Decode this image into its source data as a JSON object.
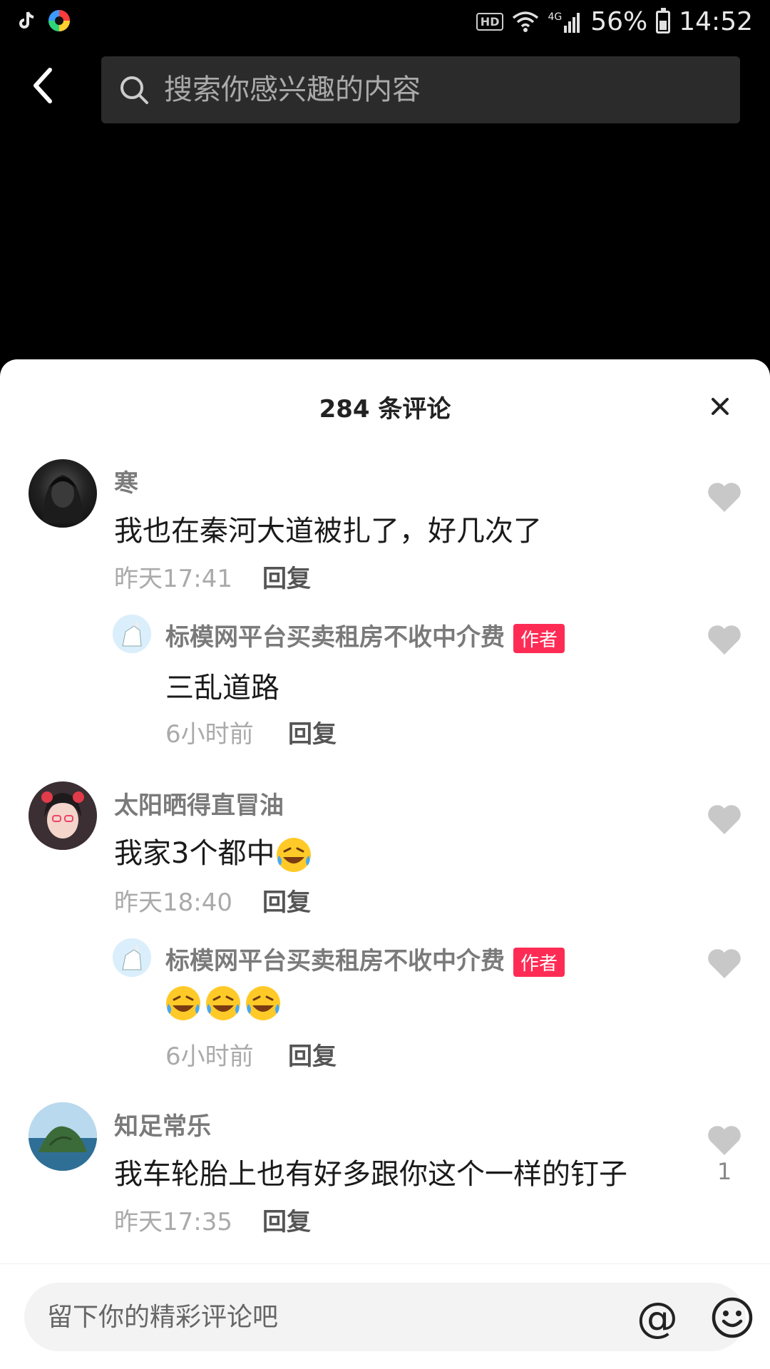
{
  "status_bar": {
    "hd": "HD",
    "network": "4G",
    "battery": "56%",
    "battery_level": 0.56,
    "time": "14:52"
  },
  "search": {
    "placeholder": "搜索你感兴趣的内容"
  },
  "comments_sheet": {
    "title": "284 条评论",
    "comments": [
      {
        "username": "寒",
        "text": "我也在秦河大道被扎了，好几次了",
        "time": "昨天17:41",
        "reply_label": "回复"
      },
      {
        "username": "标模网平台买卖租房不收中介费",
        "badge": "作者",
        "text": "三乱道路",
        "time": "6小时前",
        "reply_label": "回复"
      },
      {
        "username": "太阳晒得直冒油",
        "text": "我家3个都中",
        "text_emoji": "laughing-crying-emoji",
        "time": "昨天18:40",
        "reply_label": "回复"
      },
      {
        "username": "标模网平台买卖租房不收中介费",
        "badge": "作者",
        "text_emoji": "laughing-crying-emoji",
        "emoji_count": 3,
        "time": "6小时前",
        "reply_label": "回复"
      },
      {
        "username": "知足常乐",
        "text": "我车轮胎上也有好多跟你这个一样的钉子",
        "time": "昨天17:35",
        "reply_label": "回复",
        "likes": "1"
      }
    ]
  },
  "input_bar": {
    "placeholder": "留下你的精彩评论吧",
    "at_symbol": "@"
  },
  "colors": {
    "accent": "#fe2c55",
    "heart": "#c8c8c8"
  }
}
